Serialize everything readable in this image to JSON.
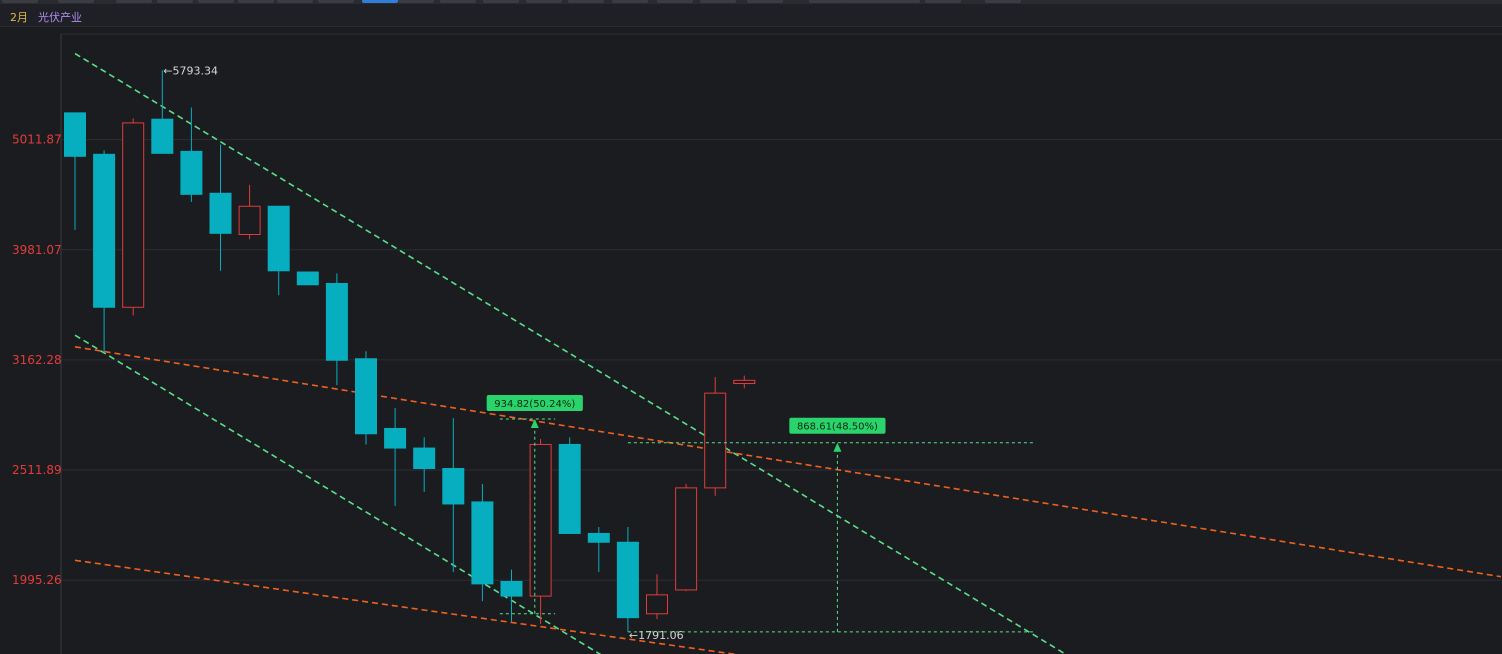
{
  "header": {
    "period": "2月",
    "sector": "光伏产业"
  },
  "colors": {
    "up": "#e03c3c",
    "down": "#06aebf",
    "channel_green": "#59e08a",
    "trend_orange": "#f0601e",
    "grid": "#2c2d33",
    "label": "#e33b3b"
  },
  "chart_data": {
    "type": "candlestick",
    "y_scale": "log",
    "ylim": [
      1710,
      6250
    ],
    "y_ticks": [
      5011.87,
      3981.07,
      3162.28,
      2511.89,
      1995.26
    ],
    "y_tick_labels": [
      "5011.87",
      "3981.07",
      "3162.28",
      "2511.89",
      "1995.26"
    ],
    "candles": [
      {
        "open": 5300,
        "high": 5300,
        "low": 4150,
        "close": 4840
      },
      {
        "open": 4860,
        "high": 4900,
        "low": 3210,
        "close": 3530
      },
      {
        "open": 3530,
        "high": 5240,
        "low": 3470,
        "close": 5190
      },
      {
        "open": 5230,
        "high": 5793.34,
        "low": 4870,
        "close": 4870
      },
      {
        "open": 4890,
        "high": 5360,
        "low": 4400,
        "close": 4470
      },
      {
        "open": 4480,
        "high": 4960,
        "low": 3810,
        "close": 4120
      },
      {
        "open": 4110,
        "high": 4560,
        "low": 4070,
        "close": 4360
      },
      {
        "open": 4360,
        "high": 4360,
        "low": 3620,
        "close": 3810
      },
      {
        "open": 3800,
        "high": 3800,
        "low": 3700,
        "close": 3700
      },
      {
        "open": 3710,
        "high": 3790,
        "low": 3000,
        "close": 3160
      },
      {
        "open": 3170,
        "high": 3220,
        "low": 2650,
        "close": 2710
      },
      {
        "open": 2740,
        "high": 2860,
        "low": 2330,
        "close": 2630
      },
      {
        "open": 2630,
        "high": 2690,
        "low": 2400,
        "close": 2520
      },
      {
        "open": 2520,
        "high": 2800,
        "low": 2030,
        "close": 2340
      },
      {
        "open": 2350,
        "high": 2440,
        "low": 1910,
        "close": 1980
      },
      {
        "open": 1990,
        "high": 2040,
        "low": 1830,
        "close": 1930
      },
      {
        "open": 1930,
        "high": 2680,
        "low": 1820,
        "close": 2650
      },
      {
        "open": 2650,
        "high": 2690,
        "low": 2200,
        "close": 2200
      },
      {
        "open": 2200,
        "high": 2230,
        "low": 2030,
        "close": 2160
      },
      {
        "open": 2160,
        "high": 2230,
        "low": 1791.06,
        "close": 1845
      },
      {
        "open": 1860,
        "high": 2020,
        "low": 1840,
        "close": 1935
      },
      {
        "open": 1955,
        "high": 2440,
        "low": 1950,
        "close": 2420
      },
      {
        "open": 2420,
        "high": 3050,
        "low": 2380,
        "close": 2950
      },
      {
        "open": 3010,
        "high": 3060,
        "low": 2980,
        "close": 3030
      }
    ],
    "annotations": [
      {
        "text": "←5793.34",
        "kind": "high"
      },
      {
        "text": "←1791.06",
        "kind": "low"
      },
      {
        "text": "934.82(50.24%)",
        "kind": "measure",
        "from_price": 1860,
        "to_price": 2794.82
      },
      {
        "text": "868.61(48.50%)",
        "kind": "measure",
        "from_price": 1791.06,
        "to_price": 2659.67
      }
    ],
    "trend_lines": [
      {
        "style": "dashed",
        "color": "channel_green",
        "points": [
          [
            0.0,
            6000
          ],
          [
            35.0,
            1650
          ]
        ]
      },
      {
        "style": "dashed",
        "color": "channel_green",
        "points": [
          [
            0.0,
            3330
          ],
          [
            19.0,
            1650
          ]
        ]
      },
      {
        "style": "dashed",
        "color": "trend_orange",
        "points": [
          [
            0.0,
            3250
          ],
          [
            49.0,
            2010
          ]
        ]
      },
      {
        "style": "dashed",
        "color": "trend_orange",
        "points": [
          [
            0.0,
            2080
          ],
          [
            25.0,
            1675
          ]
        ]
      }
    ]
  }
}
